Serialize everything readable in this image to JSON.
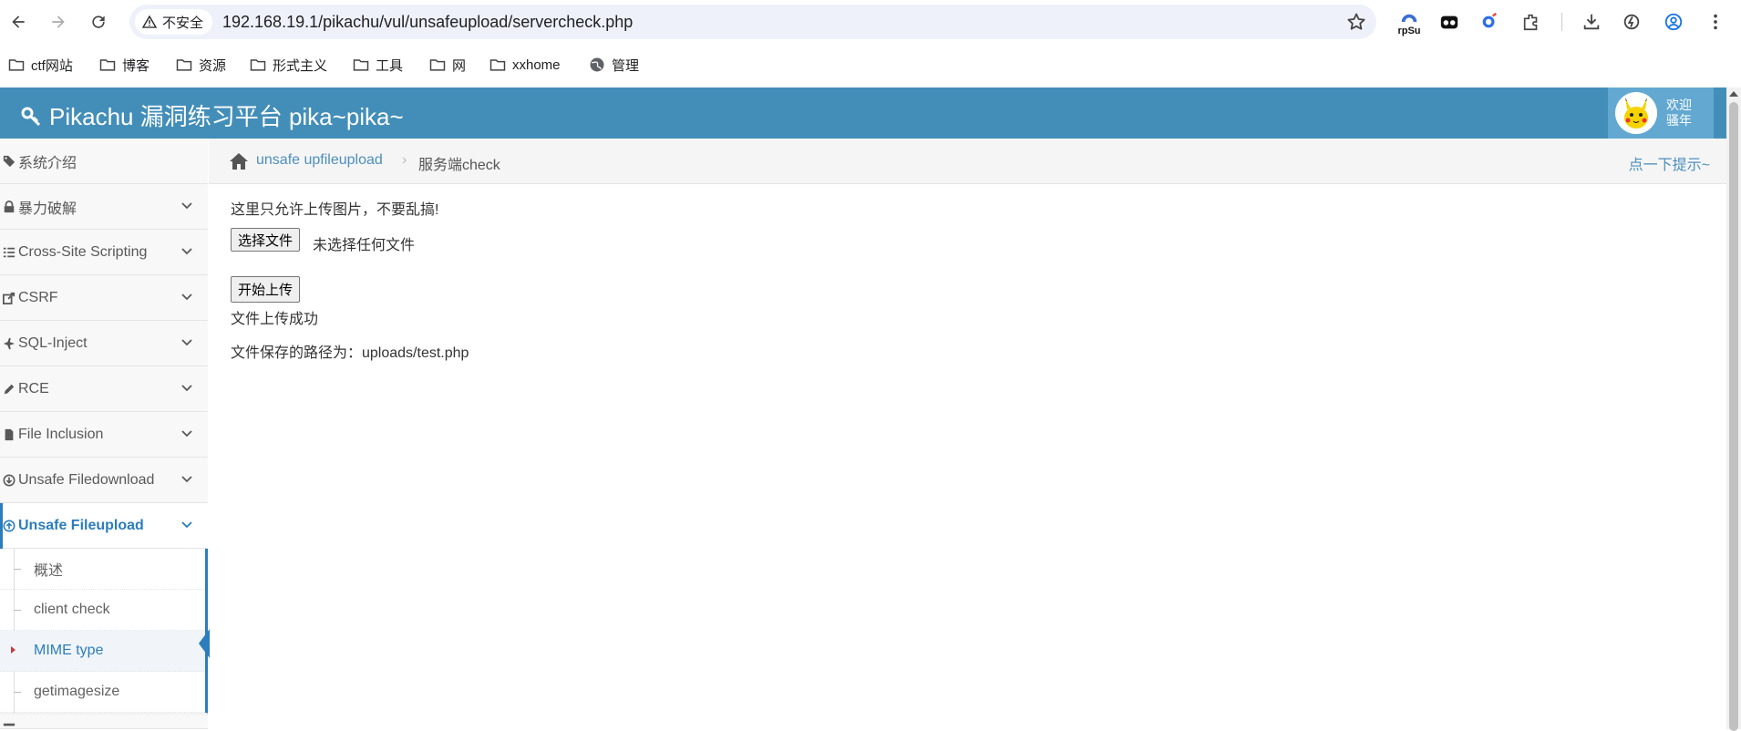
{
  "browser": {
    "security_label": "不安全",
    "url": "192.168.19.1/pikachu/vul/unsafeupload/servercheck.php",
    "ext_rpsu_label": "rpSu",
    "bookmarks": [
      "ctf网站",
      "博客",
      "资源",
      "形式主义",
      "工具",
      "网",
      "xxhome",
      "管理"
    ]
  },
  "app": {
    "title": "Pikachu 漏洞练习平台 pika~pika~",
    "welcome_line1": "欢迎",
    "welcome_line2": "骚年"
  },
  "sidebar": {
    "items": [
      {
        "label": "系统介绍",
        "icon": "tags-icon"
      },
      {
        "label": "暴力破解",
        "icon": "lock-icon"
      },
      {
        "label": "Cross-Site Scripting",
        "icon": "list-icon"
      },
      {
        "label": "CSRF",
        "icon": "share-icon"
      },
      {
        "label": "SQL-Inject",
        "icon": "fighter-jet-icon"
      },
      {
        "label": "RCE",
        "icon": "pencil-icon"
      },
      {
        "label": "File Inclusion",
        "icon": "file-icon"
      },
      {
        "label": "Unsafe Filedownload",
        "icon": "download-icon"
      },
      {
        "label": "Unsafe Fileupload",
        "icon": "upload-icon"
      }
    ],
    "subitems": [
      "概述",
      "client check",
      "MIME type",
      "getimagesize"
    ]
  },
  "breadcrumb": {
    "link": "unsafe upfileupload",
    "separator": "›",
    "current": "服务端check",
    "hint": "点一下提示~"
  },
  "content": {
    "notice": "这里只允许上传图片，不要乱搞!",
    "file_button": "选择文件",
    "file_status": "未选择任何文件",
    "upload_button": "开始上传",
    "result": "文件上传成功",
    "path_line": "文件保存的路径为：uploads/test.php"
  },
  "colors": {
    "header": "#438eb9",
    "user_box": "#62a8d1",
    "accent": "#2b7dbc",
    "link": "#4c8fbd"
  }
}
